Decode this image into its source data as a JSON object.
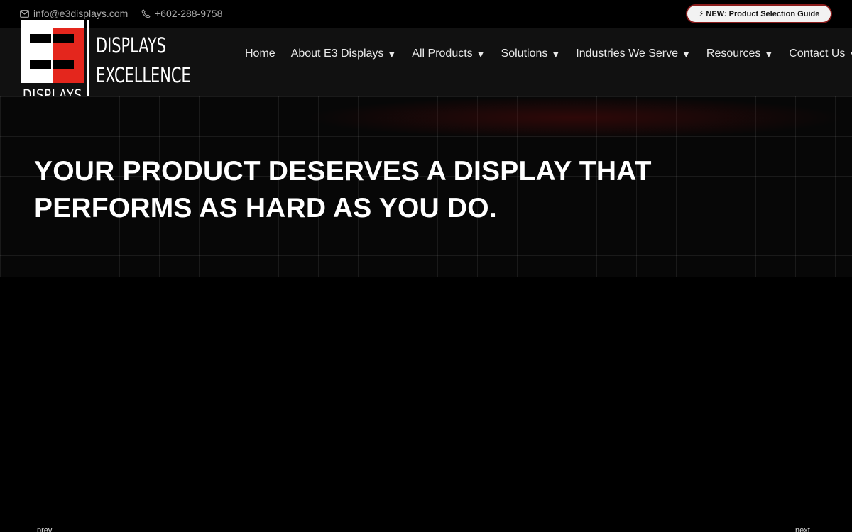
{
  "topbar": {
    "email": "info@e3displays.com",
    "phone": "+602-288-9758",
    "email_icon": "envelope-icon",
    "phone_icon": "phone-icon",
    "promo_label": "⚡ NEW: Product Selection Guide"
  },
  "logo": {
    "mark": "E3",
    "subtext": "DISPLAYS",
    "line1": "DISPLAYS",
    "line2": "EXCELLENCE",
    "brand_red": "#e4261d"
  },
  "nav": {
    "items": [
      {
        "label": "Home",
        "dropdown": false
      },
      {
        "label": "About E3 Displays",
        "dropdown": true
      },
      {
        "label": "All Products",
        "dropdown": true
      },
      {
        "label": "Solutions",
        "dropdown": true
      },
      {
        "label": "Industries We Serve",
        "dropdown": true
      },
      {
        "label": "Resources",
        "dropdown": true
      },
      {
        "label": "Contact Us",
        "dropdown": true
      }
    ],
    "caret": "▼"
  },
  "hero": {
    "title_line1": "YOUR PRODUCT DESERVES A DISPLAY THAT",
    "title_line2": "PERFORMS AS HARD AS YOU DO."
  },
  "slider": {
    "prev_label": "prev",
    "next_label": "next"
  }
}
